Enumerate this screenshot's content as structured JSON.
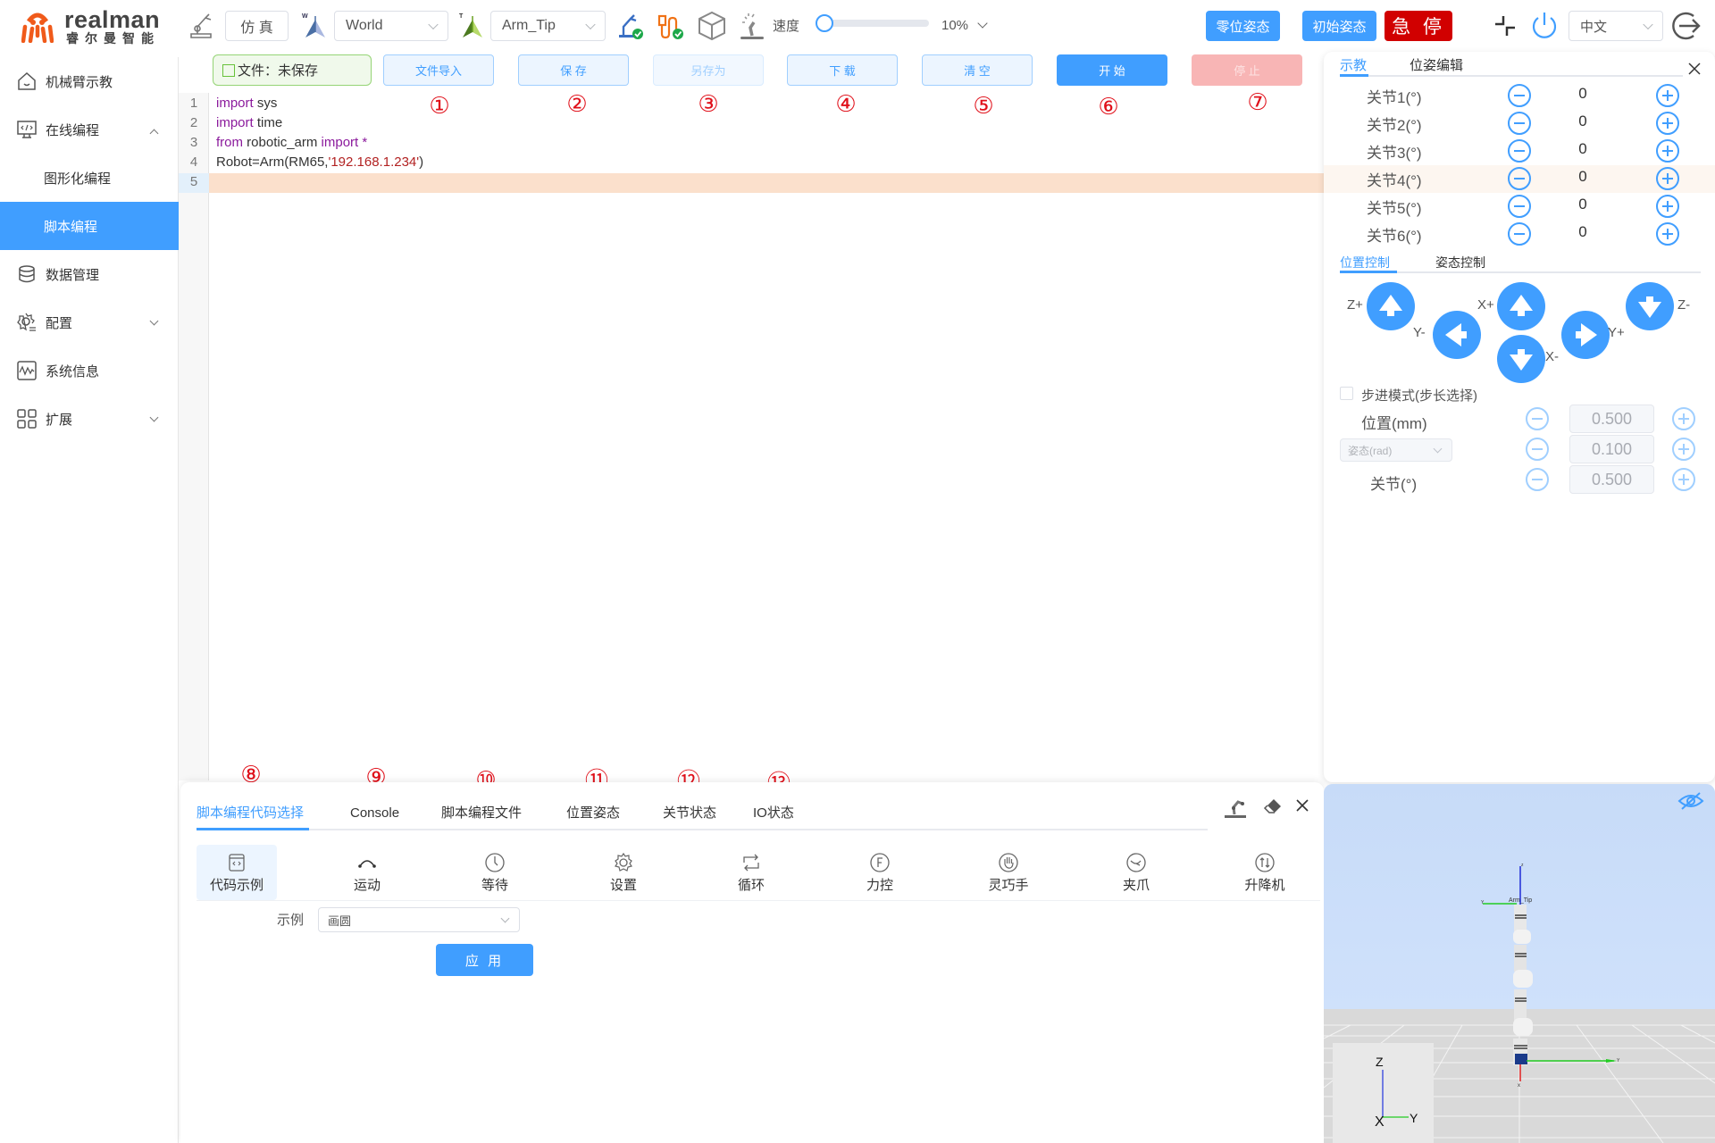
{
  "header": {
    "logo_en": "realman",
    "logo_zh": "睿尔曼智能",
    "sim_button": "仿 真",
    "frame_select": "World",
    "tool_select": "Arm_Tip",
    "speed_label": "速度",
    "speed_value": "10%",
    "speed_fraction": 0.1,
    "zero_pose_button": "零位姿态",
    "init_pose_button": "初始姿态",
    "estop_button": "急 停",
    "language_select": "中文",
    "icons": [
      "robot-arm-icon",
      "world-frame-icon",
      "tool-frame-icon",
      "arm-connected-icon",
      "controller-connected-icon",
      "cube-icon",
      "drag-teach-icon",
      "collapse-icon",
      "power-icon",
      "logout-icon"
    ]
  },
  "sidebar": {
    "items": [
      {
        "label": "机械臂示教",
        "icon": "home-icon"
      },
      {
        "label": "在线编程",
        "icon": "code-monitor-icon",
        "expanded": true
      },
      {
        "label": "图形化编程",
        "sub": true
      },
      {
        "label": "脚本编程",
        "sub": true,
        "active": true
      },
      {
        "label": "数据管理",
        "icon": "database-icon"
      },
      {
        "label": "配置",
        "icon": "settings-icon"
      },
      {
        "label": "系统信息",
        "icon": "system-monitor-icon"
      },
      {
        "label": "扩展",
        "icon": "grid-icon"
      }
    ]
  },
  "editor": {
    "file_status": "文件：未保存",
    "toolbar": {
      "import": "文件导入",
      "save": "保 存",
      "save_as": "另存为",
      "download": "下 载",
      "clear": "清 空",
      "start": "开 始",
      "stop": "停 止"
    },
    "annotations": [
      "①",
      "②",
      "③",
      "④",
      "⑤",
      "⑥",
      "⑦",
      "⑧",
      "⑨",
      "⑩",
      "⑪",
      "⑫",
      "⑬"
    ],
    "lines": [
      {
        "n": "1",
        "kw1": "import",
        "rest": " sys"
      },
      {
        "n": "2",
        "kw1": "import",
        "rest": " time"
      },
      {
        "n": "3",
        "kw1": "from",
        "mid": " robotic_arm ",
        "kw2": "import",
        "rest": " *"
      },
      {
        "n": "4",
        "pre": "Robot=Arm(RM65,",
        "str": "'192.168.1.234'",
        "post": ")"
      },
      {
        "n": "5"
      }
    ]
  },
  "bottom_panel": {
    "tabs": [
      "脚本编程代码选择",
      "Console",
      "脚本编程文件",
      "位置姿态",
      "关节状态",
      "IO状态"
    ],
    "active_tab": 0,
    "categories": [
      "代码示例",
      "运动",
      "等待",
      "设置",
      "循环",
      "力控",
      "灵巧手",
      "夹爪",
      "升降机"
    ],
    "example_label": "示例",
    "example_value": "画圆",
    "apply_button": "应 用"
  },
  "teach_panel": {
    "tabs": [
      "示教",
      "位姿编辑"
    ],
    "joints": [
      {
        "label": "关节1(°)",
        "value": "0"
      },
      {
        "label": "关节2(°)",
        "value": "0"
      },
      {
        "label": "关节3(°)",
        "value": "0"
      },
      {
        "label": "关节4(°)",
        "value": "0"
      },
      {
        "label": "关节5(°)",
        "value": "0"
      },
      {
        "label": "关节6(°)",
        "value": "0"
      }
    ],
    "control_tabs": [
      "位置控制",
      "姿态控制"
    ],
    "dpad_labels": {
      "zp": "Z+",
      "zm": "Z-",
      "xp": "X+",
      "xm": "X-",
      "yp": "Y+",
      "ym": "Y-"
    },
    "step_mode_label": "步进模式(步长选择)",
    "step_mode_checked": false,
    "steps": [
      {
        "label": "位置(mm)",
        "value": "0.500"
      },
      {
        "label": "姿态(rad)",
        "value": "0.100"
      },
      {
        "label": "关节(°)",
        "value": "0.500"
      }
    ]
  },
  "view3d": {
    "tool_label": "Arm_Tip",
    "gizmo": {
      "z": "Z",
      "x": "X",
      "y": "Y"
    },
    "axis_letters": {
      "z": "z",
      "y": "Y",
      "x": "x"
    }
  }
}
